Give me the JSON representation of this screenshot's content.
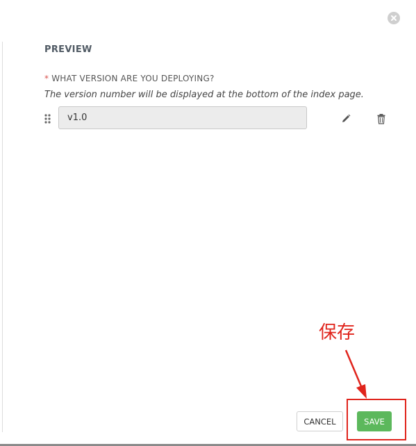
{
  "modal": {
    "section_title": "PREVIEW",
    "question": {
      "required_marker": "*",
      "label": "WHAT VERSION ARE YOU DEPLOYING?",
      "help_text": "The version number will be displayed at the bottom of the index page."
    },
    "version_field": {
      "value": "v1.0"
    },
    "icons": {
      "close": "close-icon",
      "drag": "drag-handle-icon",
      "edit": "pencil-icon",
      "delete": "trash-icon"
    }
  },
  "footer": {
    "cancel_label": "CANCEL",
    "save_label": "SAVE"
  },
  "annotation": {
    "text": "保存",
    "color": "#e0241c"
  },
  "colors": {
    "save_button": "#5cb85c",
    "required_marker": "#d9534f"
  }
}
